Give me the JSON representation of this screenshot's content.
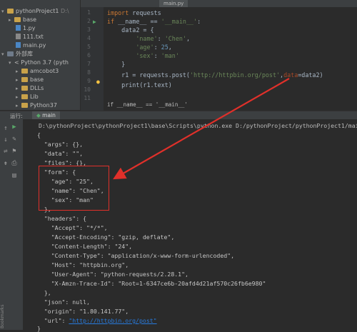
{
  "sidebar": {
    "items": [
      {
        "label": "pythonProject1",
        "suffix": "D:\\",
        "type": "folder"
      },
      {
        "label": "base",
        "suffix": "",
        "type": "folder"
      },
      {
        "label": "1.py",
        "suffix": "",
        "type": "py"
      },
      {
        "label": "111.txt",
        "suffix": "",
        "type": "txt"
      },
      {
        "label": "main.py",
        "suffix": "",
        "type": "py"
      },
      {
        "label": "外部库",
        "suffix": "",
        "type": "lib"
      },
      {
        "label": "< Python 3.7 (pyth",
        "suffix": "",
        "type": "lib"
      },
      {
        "label": "amcobot3",
        "suffix": "",
        "type": "folder"
      },
      {
        "label": "base",
        "suffix": "",
        "type": "folder"
      },
      {
        "label": "DLLs",
        "suffix": "",
        "type": "folder"
      },
      {
        "label": "Lib",
        "suffix": "",
        "type": "folder"
      },
      {
        "label": "Python37",
        "suffix": "",
        "type": "folder"
      }
    ]
  },
  "editor": {
    "tab_label": "main.py",
    "line_numbers": [
      "1",
      "2",
      "3",
      "4",
      "5",
      "6",
      "7",
      "8",
      "9",
      "10",
      "11"
    ],
    "breadcrumb": "if __name__ == '__main__'"
  },
  "code": {
    "l1_kw": "import",
    "l1_rest": " requests",
    "l2_if": "if",
    "l2_name": " __name__ == ",
    "l2_str": "'__main__'",
    "l2_colon": ":",
    "l3": "    data2 = {",
    "l4_key": "'name'",
    "l4_val": "'Chen'",
    "l5_key": "'age'",
    "l5_val": "25",
    "l6_key": "'sex'",
    "l6_val": "'man'",
    "l7": "    }",
    "l8_a": "    r1 = requests.post(",
    "l8_url": "'http://httpbin.org/post'",
    "l8_b": ",",
    "l8_param": "data",
    "l8_c": "=data2)",
    "l9": "    print(r1.text)"
  },
  "run": {
    "label": "运行:",
    "tab": "main"
  },
  "console": {
    "cmd": "D:\\pythonProject\\pythonProject1\\base\\Scripts\\python.exe D:/pythonProject/pythonProject1/main.py",
    "lines": [
      "{",
      "  \"args\": {},",
      "  \"data\": \"\",",
      "  \"files\": {},",
      "  \"form\": {",
      "    \"age\": \"25\",",
      "    \"name\": \"Chen\",",
      "    \"sex\": \"man\"",
      "  },",
      "  \"headers\": {",
      "    \"Accept\": \"*/*\",",
      "    \"Accept-Encoding\": \"gzip, deflate\",",
      "    \"Content-Length\": \"24\",",
      "    \"Content-Type\": \"application/x-www-form-urlencoded\",",
      "    \"Host\": \"httpbin.org\",",
      "    \"User-Agent\": \"python-requests/2.28.1\",",
      "    \"X-Amzn-Trace-Id\": \"Root=1-6347ce6b-20afd4d21af570c26fb6e980\"",
      "  },",
      "  \"json\": null,",
      "  \"origin\": \"1.80.141.77\","
    ],
    "url_line_prefix": "  \"url\": ",
    "url_line_link": "\"http://httpbin.org/post\"",
    "last": "}"
  },
  "colors": {
    "highlight": "#e0302a",
    "arrow": "#e0302a"
  },
  "bookmarks_label": "Bookmarks"
}
